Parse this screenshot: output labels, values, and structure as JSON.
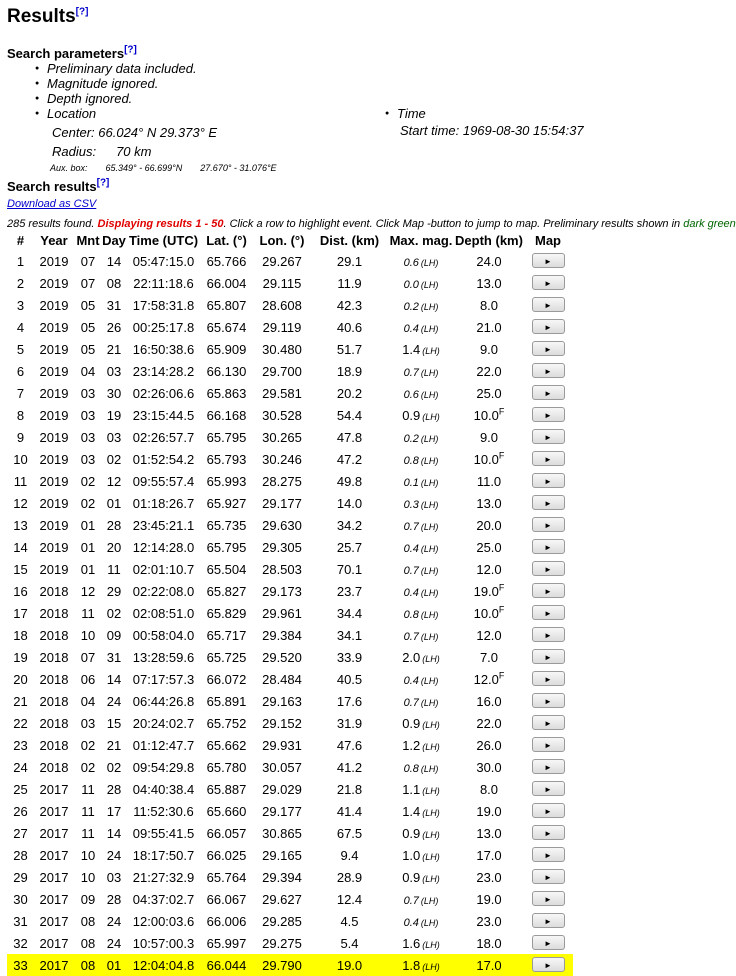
{
  "title": "Results",
  "help": "[?]",
  "search_params": {
    "heading": "Search parameters",
    "items": [
      "Preliminary data included.",
      "Magnitude ignored.",
      "Depth ignored.",
      "Location"
    ],
    "location": {
      "center_label": "Center:",
      "center_value": "66.024° N 29.373° E",
      "radius_label": "Radius:",
      "radius_value": "70 km",
      "aux_label": "Aux. box:",
      "aux_lat": "65.349° - 66.699°N",
      "aux_lon": "27.670° - 31.076°E"
    },
    "time": {
      "label": "Time",
      "start": "Start time: 1969-08-30 15:54:37"
    }
  },
  "results": {
    "heading": "Search results",
    "csv_link": "Download as CSV",
    "info_prefix": "285 results found. ",
    "info_red": "Displaying results 1 - 50",
    "info_mid": ". Click a row to highlight event. Click Map -button to jump to map. Preliminary results shown in ",
    "info_green": "dark green",
    "info_end": ".",
    "columns": [
      "#",
      "Year",
      "Mnt",
      "Day",
      "Time (UTC)",
      "Lat. (°)",
      "Lon. (°)",
      "Dist. (km)",
      "Max. mag.",
      "Depth (km)",
      "Map"
    ],
    "map_button_glyph": "►",
    "mag_unit": "(LH)",
    "highlighted_row": 33,
    "rows": [
      {
        "n": "1",
        "year": "2019",
        "mnt": "07",
        "day": "14",
        "time": "05:47:15.0",
        "lat": "65.766",
        "lon": "29.267",
        "dist": "29.1",
        "mag": "0.6",
        "prelim": true,
        "depth": "24.0",
        "f": false
      },
      {
        "n": "2",
        "year": "2019",
        "mnt": "07",
        "day": "08",
        "time": "22:11:18.6",
        "lat": "66.004",
        "lon": "29.115",
        "dist": "11.9",
        "mag": "0.0",
        "prelim": true,
        "depth": "13.0",
        "f": false
      },
      {
        "n": "3",
        "year": "2019",
        "mnt": "05",
        "day": "31",
        "time": "17:58:31.8",
        "lat": "65.807",
        "lon": "28.608",
        "dist": "42.3",
        "mag": "0.2",
        "prelim": true,
        "depth": "8.0",
        "f": false
      },
      {
        "n": "4",
        "year": "2019",
        "mnt": "05",
        "day": "26",
        "time": "00:25:17.8",
        "lat": "65.674",
        "lon": "29.119",
        "dist": "40.6",
        "mag": "0.4",
        "prelim": true,
        "depth": "21.0",
        "f": false
      },
      {
        "n": "5",
        "year": "2019",
        "mnt": "05",
        "day": "21",
        "time": "16:50:38.6",
        "lat": "65.909",
        "lon": "30.480",
        "dist": "51.7",
        "mag": "1.4",
        "prelim": false,
        "depth": "9.0",
        "f": false
      },
      {
        "n": "6",
        "year": "2019",
        "mnt": "04",
        "day": "03",
        "time": "23:14:28.2",
        "lat": "66.130",
        "lon": "29.700",
        "dist": "18.9",
        "mag": "0.7",
        "prelim": true,
        "depth": "22.0",
        "f": false
      },
      {
        "n": "7",
        "year": "2019",
        "mnt": "03",
        "day": "30",
        "time": "02:26:06.6",
        "lat": "65.863",
        "lon": "29.581",
        "dist": "20.2",
        "mag": "0.6",
        "prelim": true,
        "depth": "25.0",
        "f": false
      },
      {
        "n": "8",
        "year": "2019",
        "mnt": "03",
        "day": "19",
        "time": "23:15:44.5",
        "lat": "66.168",
        "lon": "30.528",
        "dist": "54.4",
        "mag": "0.9",
        "prelim": false,
        "depth": "10.0",
        "f": true
      },
      {
        "n": "9",
        "year": "2019",
        "mnt": "03",
        "day": "03",
        "time": "02:26:57.7",
        "lat": "65.795",
        "lon": "30.265",
        "dist": "47.8",
        "mag": "0.2",
        "prelim": true,
        "depth": "9.0",
        "f": false
      },
      {
        "n": "10",
        "year": "2019",
        "mnt": "03",
        "day": "02",
        "time": "01:52:54.2",
        "lat": "65.793",
        "lon": "30.246",
        "dist": "47.2",
        "mag": "0.8",
        "prelim": true,
        "depth": "10.0",
        "f": true
      },
      {
        "n": "11",
        "year": "2019",
        "mnt": "02",
        "day": "12",
        "time": "09:55:57.4",
        "lat": "65.993",
        "lon": "28.275",
        "dist": "49.8",
        "mag": "0.1",
        "prelim": true,
        "depth": "11.0",
        "f": false
      },
      {
        "n": "12",
        "year": "2019",
        "mnt": "02",
        "day": "01",
        "time": "01:18:26.7",
        "lat": "65.927",
        "lon": "29.177",
        "dist": "14.0",
        "mag": "0.3",
        "prelim": true,
        "depth": "13.0",
        "f": false
      },
      {
        "n": "13",
        "year": "2019",
        "mnt": "01",
        "day": "28",
        "time": "23:45:21.1",
        "lat": "65.735",
        "lon": "29.630",
        "dist": "34.2",
        "mag": "0.7",
        "prelim": true,
        "depth": "20.0",
        "f": false
      },
      {
        "n": "14",
        "year": "2019",
        "mnt": "01",
        "day": "20",
        "time": "12:14:28.0",
        "lat": "65.795",
        "lon": "29.305",
        "dist": "25.7",
        "mag": "0.4",
        "prelim": true,
        "depth": "25.0",
        "f": false
      },
      {
        "n": "15",
        "year": "2019",
        "mnt": "01",
        "day": "11",
        "time": "02:01:10.7",
        "lat": "65.504",
        "lon": "28.503",
        "dist": "70.1",
        "mag": "0.7",
        "prelim": true,
        "depth": "12.0",
        "f": false
      },
      {
        "n": "16",
        "year": "2018",
        "mnt": "12",
        "day": "29",
        "time": "02:22:08.0",
        "lat": "65.827",
        "lon": "29.173",
        "dist": "23.7",
        "mag": "0.4",
        "prelim": true,
        "depth": "19.0",
        "f": true
      },
      {
        "n": "17",
        "year": "2018",
        "mnt": "11",
        "day": "02",
        "time": "02:08:51.0",
        "lat": "65.829",
        "lon": "29.961",
        "dist": "34.4",
        "mag": "0.8",
        "prelim": true,
        "depth": "10.0",
        "f": true
      },
      {
        "n": "18",
        "year": "2018",
        "mnt": "10",
        "day": "09",
        "time": "00:58:04.0",
        "lat": "65.717",
        "lon": "29.384",
        "dist": "34.1",
        "mag": "0.7",
        "prelim": true,
        "depth": "12.0",
        "f": false
      },
      {
        "n": "19",
        "year": "2018",
        "mnt": "07",
        "day": "31",
        "time": "13:28:59.6",
        "lat": "65.725",
        "lon": "29.520",
        "dist": "33.9",
        "mag": "2.0",
        "prelim": false,
        "depth": "7.0",
        "f": false
      },
      {
        "n": "20",
        "year": "2018",
        "mnt": "06",
        "day": "14",
        "time": "07:17:57.3",
        "lat": "66.072",
        "lon": "28.484",
        "dist": "40.5",
        "mag": "0.4",
        "prelim": true,
        "depth": "12.0",
        "f": true
      },
      {
        "n": "21",
        "year": "2018",
        "mnt": "04",
        "day": "24",
        "time": "06:44:26.8",
        "lat": "65.891",
        "lon": "29.163",
        "dist": "17.6",
        "mag": "0.7",
        "prelim": true,
        "depth": "16.0",
        "f": false
      },
      {
        "n": "22",
        "year": "2018",
        "mnt": "03",
        "day": "15",
        "time": "20:24:02.7",
        "lat": "65.752",
        "lon": "29.152",
        "dist": "31.9",
        "mag": "0.9",
        "prelim": false,
        "depth": "22.0",
        "f": false
      },
      {
        "n": "23",
        "year": "2018",
        "mnt": "02",
        "day": "21",
        "time": "01:12:47.7",
        "lat": "65.662",
        "lon": "29.931",
        "dist": "47.6",
        "mag": "1.2",
        "prelim": false,
        "depth": "26.0",
        "f": false
      },
      {
        "n": "24",
        "year": "2018",
        "mnt": "02",
        "day": "02",
        "time": "09:54:29.8",
        "lat": "65.780",
        "lon": "30.057",
        "dist": "41.2",
        "mag": "0.8",
        "prelim": true,
        "depth": "30.0",
        "f": false
      },
      {
        "n": "25",
        "year": "2017",
        "mnt": "11",
        "day": "28",
        "time": "04:40:38.4",
        "lat": "65.887",
        "lon": "29.029",
        "dist": "21.8",
        "mag": "1.1",
        "prelim": false,
        "depth": "8.0",
        "f": false
      },
      {
        "n": "26",
        "year": "2017",
        "mnt": "11",
        "day": "17",
        "time": "11:52:30.6",
        "lat": "65.660",
        "lon": "29.177",
        "dist": "41.4",
        "mag": "1.4",
        "prelim": false,
        "depth": "19.0",
        "f": false
      },
      {
        "n": "27",
        "year": "2017",
        "mnt": "11",
        "day": "14",
        "time": "09:55:41.5",
        "lat": "66.057",
        "lon": "30.865",
        "dist": "67.5",
        "mag": "0.9",
        "prelim": false,
        "depth": "13.0",
        "f": false
      },
      {
        "n": "28",
        "year": "2017",
        "mnt": "10",
        "day": "24",
        "time": "18:17:50.7",
        "lat": "66.025",
        "lon": "29.165",
        "dist": "9.4",
        "mag": "1.0",
        "prelim": false,
        "depth": "17.0",
        "f": false
      },
      {
        "n": "29",
        "year": "2017",
        "mnt": "10",
        "day": "03",
        "time": "21:27:32.9",
        "lat": "65.764",
        "lon": "29.394",
        "dist": "28.9",
        "mag": "0.9",
        "prelim": false,
        "depth": "23.0",
        "f": false
      },
      {
        "n": "30",
        "year": "2017",
        "mnt": "09",
        "day": "28",
        "time": "04:37:02.7",
        "lat": "66.067",
        "lon": "29.627",
        "dist": "12.4",
        "mag": "0.7",
        "prelim": true,
        "depth": "19.0",
        "f": false
      },
      {
        "n": "31",
        "year": "2017",
        "mnt": "08",
        "day": "24",
        "time": "12:00:03.6",
        "lat": "66.006",
        "lon": "29.285",
        "dist": "4.5",
        "mag": "0.4",
        "prelim": true,
        "depth": "23.0",
        "f": false
      },
      {
        "n": "32",
        "year": "2017",
        "mnt": "08",
        "day": "24",
        "time": "10:57:00.3",
        "lat": "65.997",
        "lon": "29.275",
        "dist": "5.4",
        "mag": "1.6",
        "prelim": false,
        "depth": "18.0",
        "f": false
      },
      {
        "n": "33",
        "year": "2017",
        "mnt": "08",
        "day": "01",
        "time": "12:04:04.8",
        "lat": "66.044",
        "lon": "29.790",
        "dist": "19.0",
        "mag": "1.8",
        "prelim": false,
        "depth": "17.0",
        "f": false
      }
    ],
    "depth_flag": "F",
    "highlight_color": "#ffff00",
    "link_color": "#0000cc",
    "warning_color": "#e00000",
    "prelim_note_color": "#006600"
  }
}
